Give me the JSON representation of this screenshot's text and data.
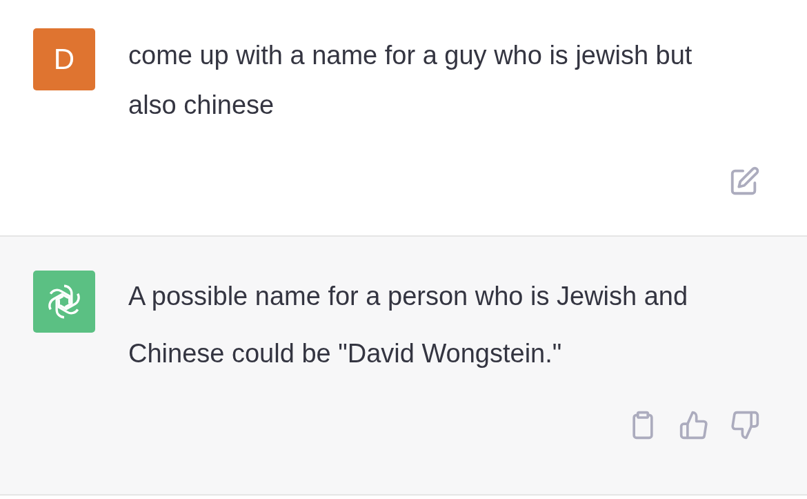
{
  "messages": [
    {
      "kind": "user",
      "avatar_letter": "D",
      "color": "#df7430",
      "text": "come up with a name for a guy who is jewish but also chinese"
    },
    {
      "kind": "assistant",
      "color": "#5bc083",
      "text": "A possible name for a person who is Jewish and Chinese could be \"David Wongstein.\""
    }
  ]
}
